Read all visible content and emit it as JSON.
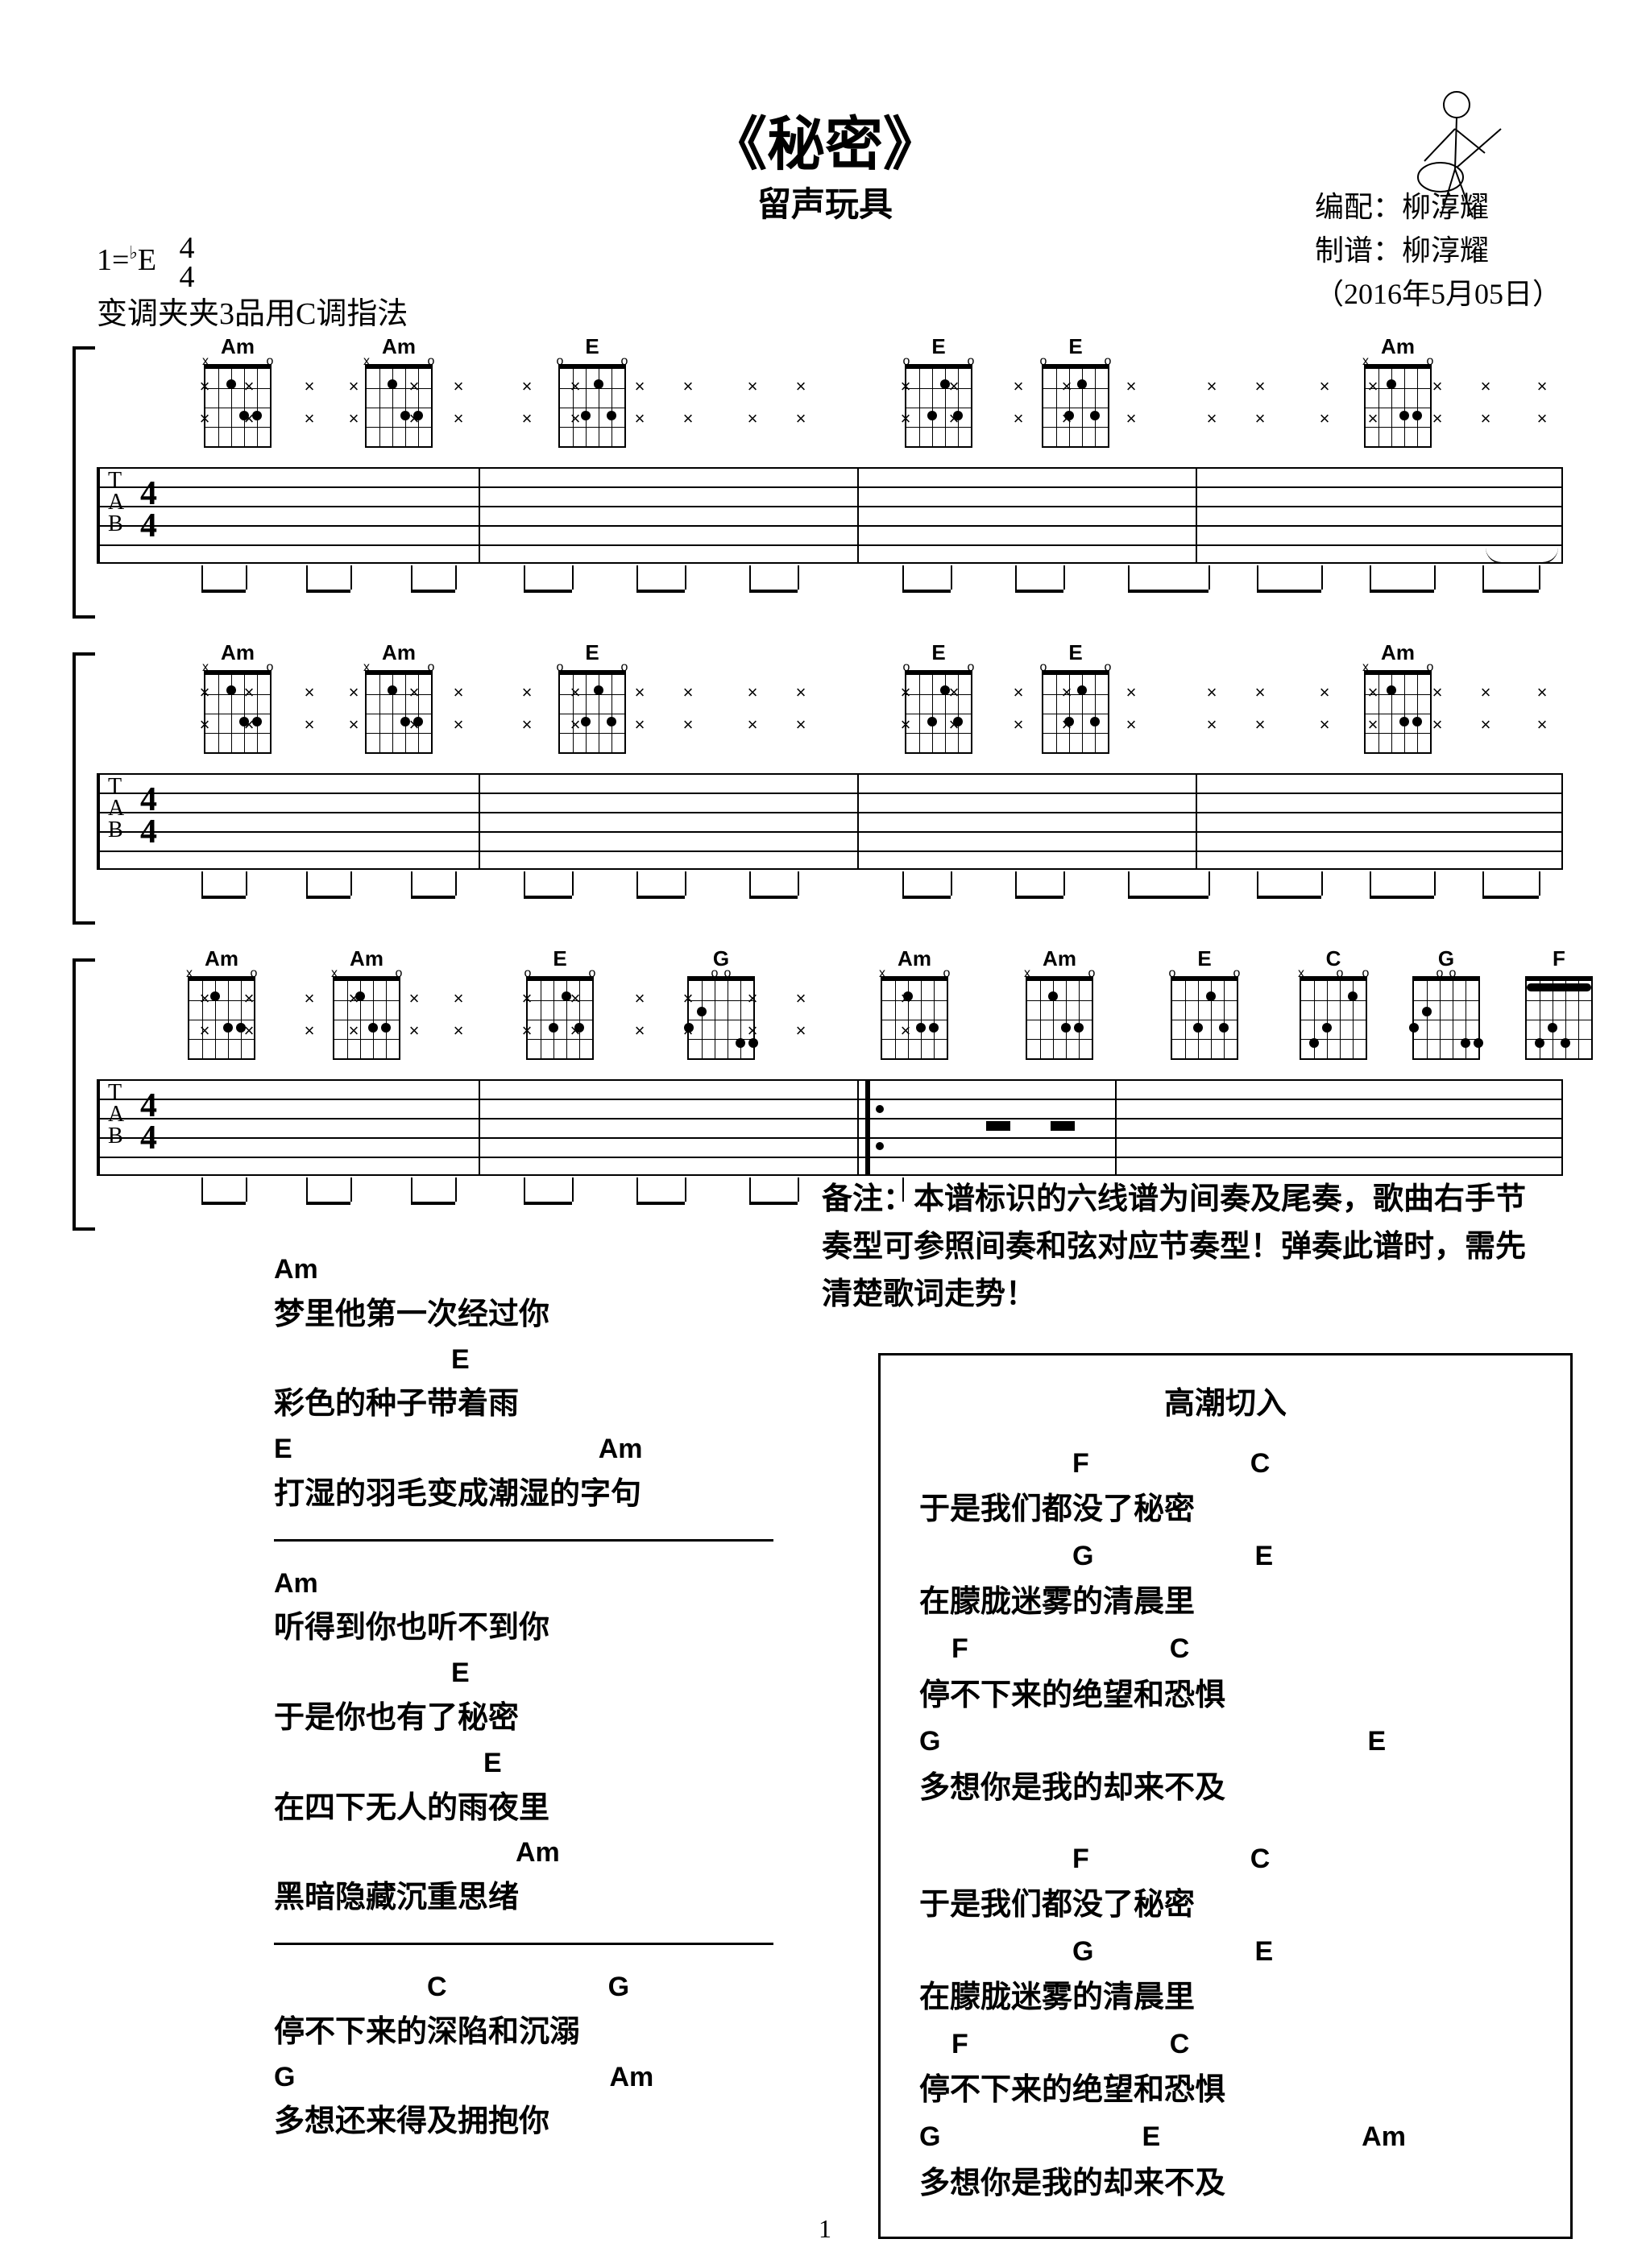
{
  "title": "《秘密》",
  "artist": "留声玩具",
  "credits": {
    "arranger_label": "编配：",
    "arranger": "柳淳耀",
    "transcriber_label": "制谱：",
    "transcriber": "柳淳耀",
    "date": "（2016年5月05日）"
  },
  "key_info": {
    "line1_prefix": "1=",
    "flat": "♭",
    "line1_key": "E",
    "timesig_top": "4",
    "timesig_bottom": "4",
    "line2": "变调夹夹3品用C调指法"
  },
  "chords_row1": [
    "Am",
    "Am",
    "E",
    "E",
    "E",
    "Am"
  ],
  "chords_row2": [
    "Am",
    "Am",
    "E",
    "E",
    "E",
    "Am"
  ],
  "chords_row3": [
    "Am",
    "Am",
    "E",
    "G",
    "Am",
    "Am",
    "E",
    "C",
    "G",
    "F"
  ],
  "verse1": [
    {
      "chord": "Am",
      "text": "梦里他第一次经过你"
    },
    {
      "chord": "E",
      "text": "彩色的种子带着雨",
      "chord_indent": 220
    },
    {
      "chord": "E",
      "chord2": "Am",
      "text": "打湿的羽毛变成潮湿的字句",
      "chord2_indent": 420
    }
  ],
  "verse2": [
    {
      "chord": "Am",
      "text": "听得到你也听不到你"
    },
    {
      "chord": "E",
      "text": "于是你也有了秘密",
      "chord_indent": 220
    },
    {
      "chord": "E",
      "text": "在四下无人的雨夜里",
      "chord_indent": 260
    },
    {
      "chord": "Am",
      "text": "黑暗隐藏沉重思绪",
      "chord_indent": 300
    }
  ],
  "bridge": [
    {
      "chords": [
        "C",
        "G"
      ],
      "indents": [
        190,
        420
      ],
      "text": "停不下来的深陷和沉溺"
    },
    {
      "chords": [
        "G",
        "Am"
      ],
      "indents": [
        0,
        420
      ],
      "text": "多想还来得及拥抱你"
    }
  ],
  "note_label": "备注：",
  "note_text": "本谱标识的六线谱为间奏及尾奏，歌曲右手节奏型可参照间奏和弦对应节奏型！弹奏此谱时，需先清楚歌词走势！",
  "chorus_title": "高潮切入",
  "chorus1": [
    {
      "chords": [
        "F",
        "C"
      ],
      "indents": [
        190,
        420
      ],
      "text": "于是我们都没了秘密"
    },
    {
      "chords": [
        "G",
        "E"
      ],
      "indents": [
        190,
        420
      ],
      "text": "在朦胧迷雾的清晨里"
    },
    {
      "chords": [
        "F",
        "C"
      ],
      "indents": [
        40,
        320
      ],
      "text": "停不下来的绝望和恐惧"
    },
    {
      "chords": [
        "G",
        "E"
      ],
      "indents": [
        0,
        560
      ],
      "text": "多想你是我的却来不及"
    }
  ],
  "chorus2": [
    {
      "chords": [
        "F",
        "C"
      ],
      "indents": [
        190,
        420
      ],
      "text": "于是我们都没了秘密"
    },
    {
      "chords": [
        "G",
        "E"
      ],
      "indents": [
        190,
        420
      ],
      "text": "在朦胧迷雾的清晨里"
    },
    {
      "chords": [
        "F",
        "C"
      ],
      "indents": [
        40,
        320
      ],
      "text": "停不下来的绝望和恐惧"
    },
    {
      "chords": [
        "G",
        "E",
        "Am"
      ],
      "indents": [
        0,
        280,
        560
      ],
      "text": "多想你是我的却来不及"
    }
  ],
  "page_number": "1",
  "tab_label_T": "T",
  "tab_label_A": "A",
  "tab_label_B": "B"
}
